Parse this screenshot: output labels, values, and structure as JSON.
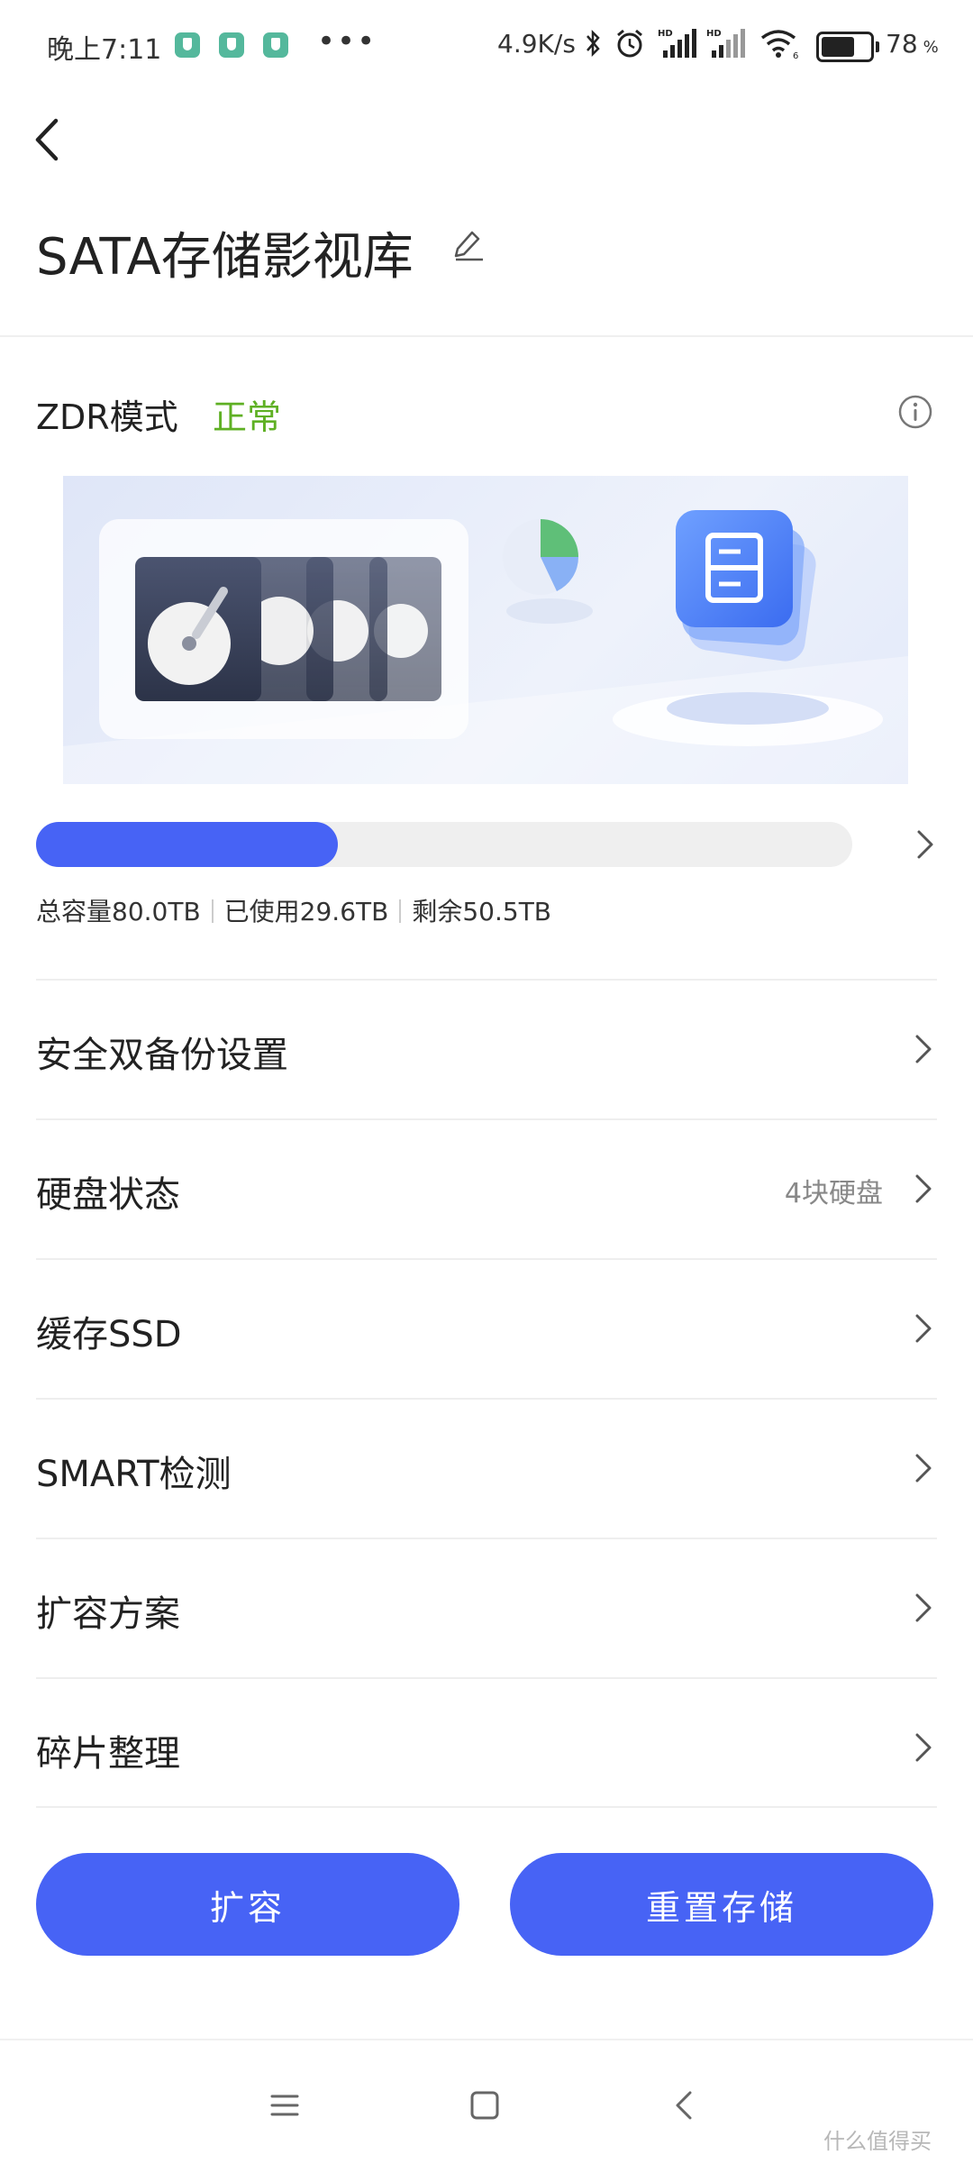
{
  "status_bar": {
    "time": "晚上7:11",
    "dots": "•••",
    "speed": "4.9K/s",
    "battery_pct": "78",
    "battery_level": 0.78,
    "pct_symbol": "%",
    "icons": [
      "shield-icon",
      "shield-icon",
      "shield-icon",
      "bluetooth-icon",
      "alarm-icon",
      "signal-hd-icon",
      "signal-hd-icon",
      "wifi-icon",
      "battery-icon"
    ]
  },
  "header": {
    "title": "SATA存储影视库",
    "icons": [
      "back-arrow-icon",
      "edit-icon"
    ]
  },
  "zdr": {
    "label": "ZDR模式",
    "status": "正常",
    "status_color": "#5fb024",
    "info_icon": "info-icon"
  },
  "storage": {
    "used_fraction": 0.37,
    "total": "总容量80.0TB",
    "used": "已使用29.6TB",
    "remaining": "剩余50.5TB",
    "accent": "#4763f5"
  },
  "menu": {
    "items": [
      {
        "label": "安全双备份设置",
        "value": ""
      },
      {
        "label": "硬盘状态",
        "value": "4块硬盘"
      },
      {
        "label": "缓存SSD",
        "value": ""
      },
      {
        "label": "SMART检测",
        "value": ""
      },
      {
        "label": "扩容方案",
        "value": ""
      },
      {
        "label": "碎片整理",
        "value": ""
      }
    ]
  },
  "actions": {
    "expand_label": "扩容",
    "reset_label": "重置存储"
  },
  "nav": {
    "icons": [
      "menu-icon",
      "home-icon",
      "back-icon"
    ]
  },
  "watermark": "什么值得买"
}
